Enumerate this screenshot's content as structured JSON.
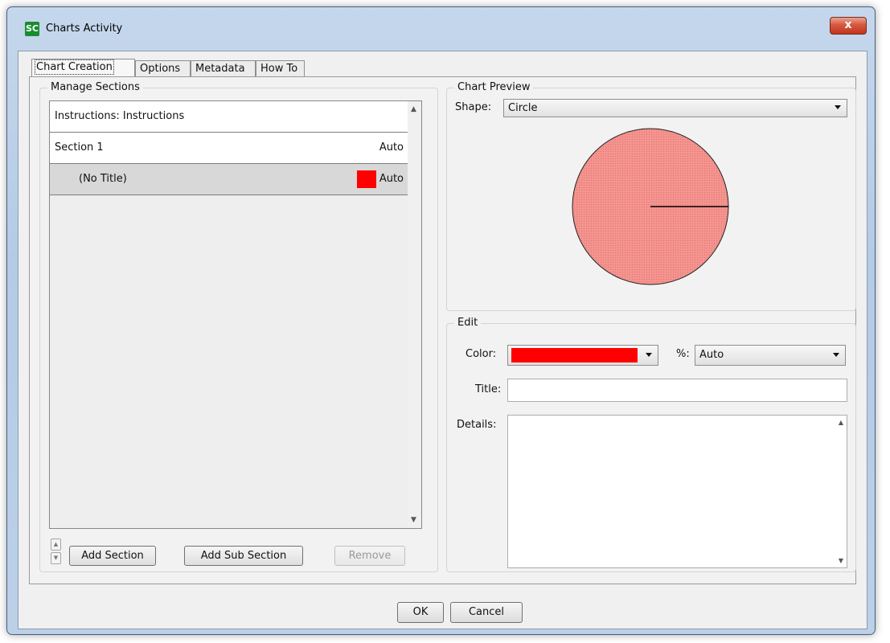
{
  "window": {
    "app_icon_text": "SC",
    "title": "Charts Activity",
    "close_glyph": "x"
  },
  "tabs": [
    "Chart Creation",
    "Options",
    "Metadata",
    "How To"
  ],
  "manage_sections": {
    "legend": "Manage Sections",
    "rows": [
      {
        "label": "Instructions: Instructions",
        "value": ""
      },
      {
        "label": "Section 1",
        "value": "Auto"
      },
      {
        "label": "(No Title)",
        "value": "Auto",
        "color": "#ff0000",
        "selected": true
      }
    ],
    "buttons": {
      "add_section": "Add Section",
      "add_sub_section": "Add Sub Section",
      "remove": "Remove"
    },
    "move_up_glyph": "▲",
    "move_down_glyph": "▼"
  },
  "chart_preview": {
    "legend": "Chart Preview",
    "shape_label": "Shape:",
    "shape_value": "Circle",
    "slice_color": "#f08080"
  },
  "edit": {
    "legend": "Edit",
    "color_label": "Color:",
    "color_value": "#ff0000",
    "percent_label": "%:",
    "percent_value": "Auto",
    "title_label": "Title:",
    "title_value": "",
    "details_label": "Details:",
    "details_value": ""
  },
  "footer": {
    "ok": "OK",
    "cancel": "Cancel"
  }
}
